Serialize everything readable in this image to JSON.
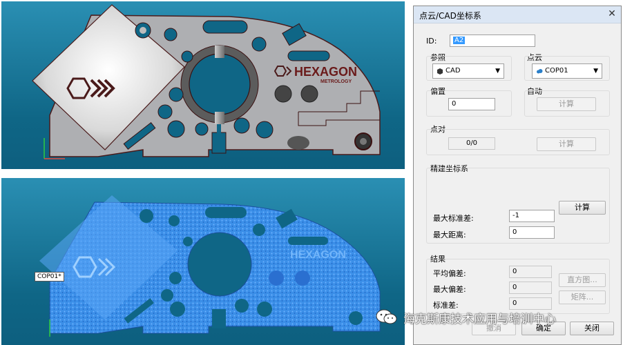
{
  "viewer": {
    "cad_brand": "HEXAGON",
    "cad_sub": "METROLOGY",
    "pointcloud_tag": "COP01*"
  },
  "dialog": {
    "title": "点云/CAD坐标系",
    "id_label": "ID:",
    "id_value": "A2",
    "reference_label": "参照",
    "reference_value": "CAD",
    "pointcloud_label": "点云",
    "pointcloud_value": "COP01",
    "offset_label": "偏置",
    "offset_value": "0",
    "auto_label": "自动",
    "auto_calc": "计算",
    "pairs_label": "点对",
    "pairs_value": "0/0",
    "pairs_calc": "计算",
    "refine_label": "精建坐标系",
    "max_std_label": "最大标准差:",
    "max_std_value": "-1",
    "max_dist_label": "最大距离:",
    "max_dist_value": "0",
    "refine_calc": "计算",
    "results_label": "结果",
    "avg_dev_label": "平均偏差:",
    "avg_dev_value": "0",
    "max_dev_label": "最大偏差:",
    "max_dev_value": "0",
    "std_label": "标准差:",
    "std_value": "0",
    "histogram_btn": "直方图...",
    "matrix_btn": "矩阵...",
    "undo_btn": "撤消",
    "ok_btn": "确定",
    "close_btn": "关闭"
  },
  "watermark": "海克斯康技术应用与培训中心",
  "colors": {
    "viewport": "#0f6686",
    "part": "#a9aaad",
    "scan": "#3b8fe8",
    "accent": "#3399ff"
  }
}
